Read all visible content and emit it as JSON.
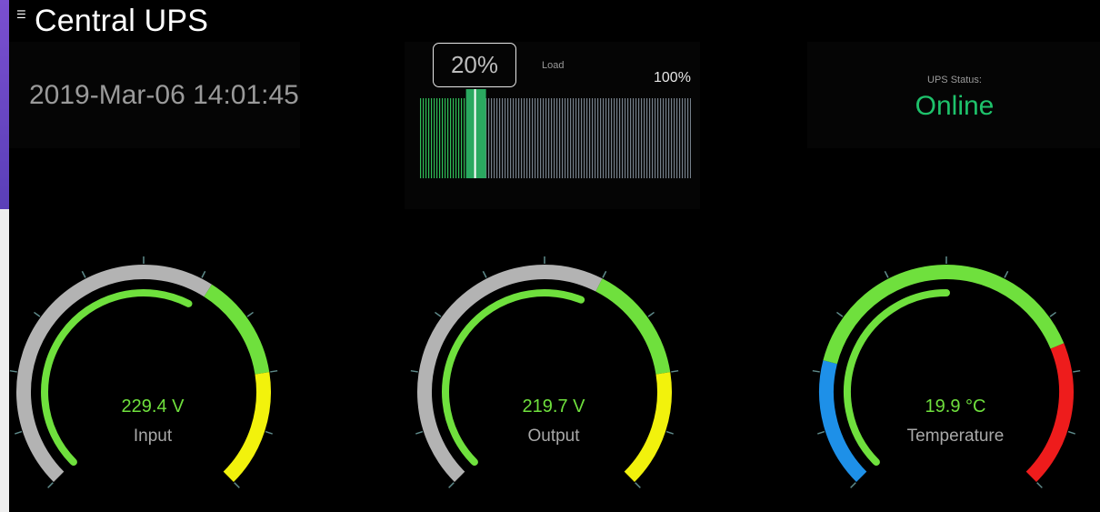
{
  "header": {
    "title": "Central UPS",
    "menu_icon": "menu-icon"
  },
  "clock": {
    "datetime": "2019-Mar-06 14:01:45"
  },
  "load": {
    "label": "Load",
    "value_text": "20%",
    "max_text": "100%",
    "value": 20,
    "max": 100
  },
  "status": {
    "label": "UPS Status:",
    "value": "Online",
    "color": "#1ec26b"
  },
  "gauges": [
    {
      "value_text": "229.4 V",
      "label": "Input",
      "fraction": 0.6
    },
    {
      "value_text": "219.7 V",
      "label": "Output",
      "fraction": 0.58
    },
    {
      "value_text": "19.9 °C",
      "label": "Temperature",
      "fraction": 0.5
    }
  ],
  "colors": {
    "green": "#6fe03d",
    "grey": "#b3b3b3",
    "yellow": "#f2f20c",
    "blue": "#1e90e8",
    "red": "#ee1c1c",
    "tick": "#5e8a8a"
  }
}
